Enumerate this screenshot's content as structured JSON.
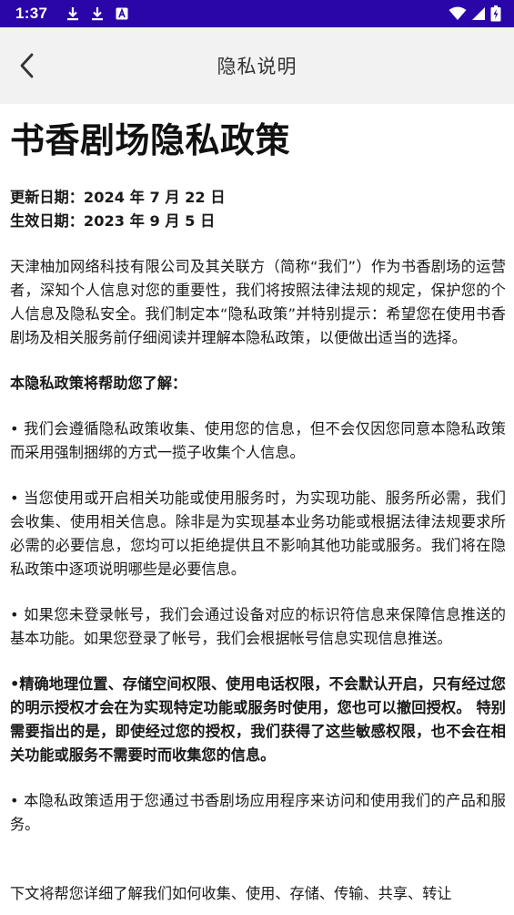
{
  "status_bar": {
    "time": "1:37",
    "left_icons": [
      "download-icon",
      "download-icon",
      "notification-icon"
    ],
    "right_icons": [
      "wifi-icon",
      "signal-icon",
      "battery-charging-icon"
    ]
  },
  "app_bar": {
    "back_icon": "chevron-left-icon",
    "title": "隐私说明"
  },
  "document": {
    "title": "书香剧场隐私政策",
    "updated_date": "更新日期：2024 年 7 月 22 日",
    "effective_date": "生效日期：2023 年 9 月 5 日",
    "intro": "天津柚加网络科技有限公司及其关联方（简称“我们”）作为书香剧场的运营者，深知个人信息对您的重要性，我们将按照法律法规的规定，保护您的个人信息及隐私安全。我们制定本“隐私政策”并特别提示：希望您在使用书香剧场及相关服务前仔细阅读并理解本隐私政策，以便做出适当的选择。",
    "summary_heading": "本隐私政策将帮助您了解：",
    "bullets": [
      "• 我们会遵循隐私政策收集、使用您的信息，但不会仅因您同意本隐私政策而采用强制捆绑的方式一揽子收集个人信息。",
      "• 当您使用或开启相关功能或使用服务时，为实现功能、服务所必需，我们会收集、使用相关信息。除非是为实现基本业务功能或根据法律法规要求所必需的必要信息，您均可以拒绝提供且不影响其他功能或服务。我们将在隐私政策中逐项说明哪些是必要信息。",
      "• 如果您未登录帐号，我们会通过设备对应的标识符信息来保障信息推送的基本功能。如果您登录了帐号，我们会根据帐号信息实现信息推送。"
    ],
    "bold_bullet": "•精确地理位置、存储空间权限、使用电话权限，不会默认开启，只有经过您的明示授权才会在为实现特定功能或服务时使用，您也可以撤回授权。 特别需要指出的是，即使经过您的授权，我们获得了这些敏感权限，也不会在相关功能或服务不需要时而收集您的信息。",
    "scope_bullet": "• 本隐私政策适用于您通过书香剧场应用程序来访问和使用我们的产品和服务。",
    "next_paragraph": "下文将帮您详细了解我们如何收集、使用、存储、传输、共享、转让"
  }
}
